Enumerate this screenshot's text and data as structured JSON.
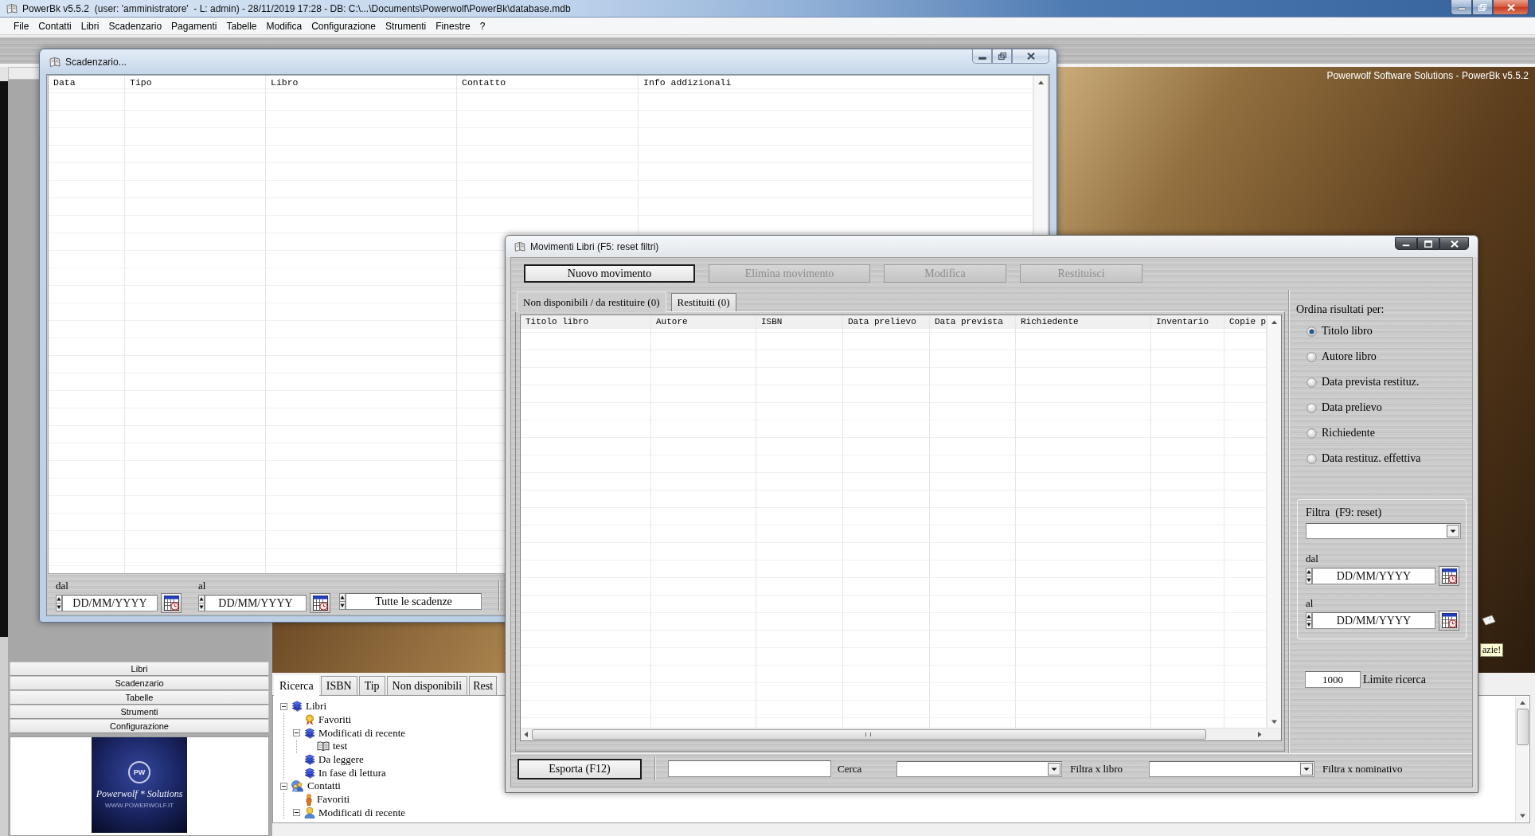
{
  "app": {
    "title": "PowerBk v5.5.2  (user: 'amministratore'  - L: admin) - 28/11/2019 17:28 - DB: C:\\...\\Documents\\Powerwolf\\PowerBk\\database.mdb"
  },
  "menu": [
    "File",
    "Contatti",
    "Libri",
    "Scadenzario",
    "Pagamenti",
    "Tabelle",
    "Modifica",
    "Configurazione",
    "Strumenti",
    "Finestre",
    "?"
  ],
  "background": {
    "caption": "Powerwolf Software Solutions - PowerBk v5.5.2",
    "tooltip": "azie!"
  },
  "sidebar": {
    "items": [
      "Libri",
      "Scadenzario",
      "Tabelle",
      "Strumenti",
      "Configurazione"
    ],
    "logo": {
      "monogram": "PW",
      "name": "Powerwolf * Solutions",
      "url": "WWW.POWERWOLF.IT"
    }
  },
  "search_panel": {
    "tabs": [
      {
        "label": "Ricerca",
        "selected": true
      },
      {
        "label": "ISBN",
        "selected": false
      },
      {
        "label": "Tip",
        "selected": false
      },
      {
        "label": "Non disponibili",
        "selected": false
      },
      {
        "label": "Rest",
        "selected": false
      }
    ],
    "tree": [
      {
        "label": "Libri",
        "kind": "book-list",
        "expanded": true,
        "children": [
          {
            "label": "Favoriti",
            "kind": "favorites"
          },
          {
            "label": "Modificati di recente",
            "kind": "book-list",
            "expanded": true,
            "children": [
              {
                "label": "test",
                "kind": "book"
              }
            ]
          },
          {
            "label": "Da leggere",
            "kind": "book-list"
          },
          {
            "label": "In fase di lettura",
            "kind": "book-list"
          }
        ]
      },
      {
        "label": "Contatti",
        "kind": "contacts",
        "expanded": true,
        "children": [
          {
            "label": "Favoriti",
            "kind": "contact-favorites"
          },
          {
            "label": "Modificati di recente",
            "kind": "contact-list",
            "expanded": true
          }
        ]
      }
    ]
  },
  "scadenzario": {
    "title": "Scadenzario...",
    "columns": [
      "Data",
      "Tipo",
      "Libro",
      "Contatto",
      "Info addizionali"
    ],
    "from": {
      "label": "dal",
      "placeholder": "DD/MM/YYYY"
    },
    "to": {
      "label": "al",
      "placeholder": "DD/MM/YYYY"
    },
    "filter": {
      "value": "Tutte le scadenze"
    }
  },
  "movimenti": {
    "title": "Movimenti Libri (F5: reset filtri)",
    "toolbar": [
      {
        "label": "Nuovo movimento",
        "disabled": false
      },
      {
        "label": "Elimina movimento",
        "disabled": true
      },
      {
        "label": "Modifica",
        "disabled": true
      },
      {
        "label": "Restituisci",
        "disabled": true
      }
    ],
    "tabs": [
      {
        "label": "Non disponibili / da restituire (0)",
        "selected": true
      },
      {
        "label": "Restituiti (0)",
        "selected": false
      }
    ],
    "columns": [
      "Titolo libro",
      "Autore",
      "ISBN",
      "Data prelievo",
      "Data prevista",
      "Richiedente",
      "Inventario",
      "Copie p"
    ],
    "sort": {
      "label": "Ordina risultati per:",
      "options": [
        {
          "label": "Titolo libro",
          "selected": true
        },
        {
          "label": "Autore libro",
          "selected": false
        },
        {
          "label": "Data prevista restituz.",
          "selected": false
        },
        {
          "label": "Data prelievo",
          "selected": false
        },
        {
          "label": "Richiedente",
          "selected": false
        },
        {
          "label": "Data restituz. effettiva",
          "selected": false
        }
      ]
    },
    "filter": {
      "label": "Filtra  (F9: reset)",
      "from": {
        "label": "dal",
        "placeholder": "DD/MM/YYYY"
      },
      "to": {
        "label": "al",
        "placeholder": "DD/MM/YYYY"
      }
    },
    "limit": {
      "value": "1000",
      "label": "Limite ricerca"
    },
    "footer": {
      "export_button": "Esporta (F12)",
      "search_label": "Cerca",
      "book_filter_label": "Filtra x libro",
      "name_filter_label": "Filtra x nominativo"
    }
  }
}
